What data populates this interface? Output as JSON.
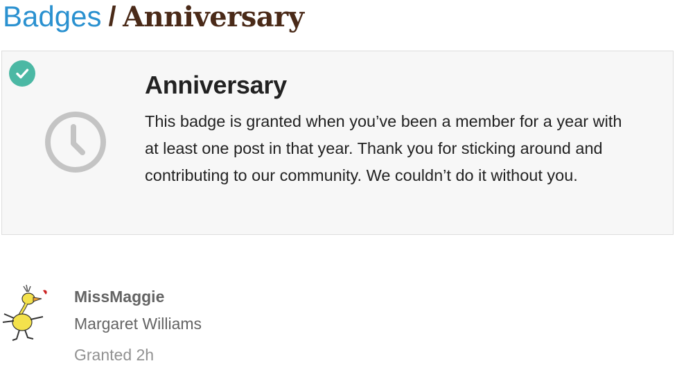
{
  "breadcrumb": {
    "parent": "Badges",
    "separator": "/",
    "current": "Anniversary"
  },
  "badge": {
    "name": "Anniversary",
    "description": "This badge is granted when you’ve been a member for a year with at least one post in that year. Thank you for sticking around and contributing to our community. We couldn’t do it without you.",
    "icon": "clock-icon",
    "granted": true
  },
  "grantee": {
    "username": "MissMaggie",
    "full_name": "Margaret Williams",
    "granted_label": "Granted 2h"
  },
  "colors": {
    "link": "#2a91d0",
    "title": "#4a2a18",
    "check": "#4bb8a4",
    "icon": "#c4c4c4"
  }
}
